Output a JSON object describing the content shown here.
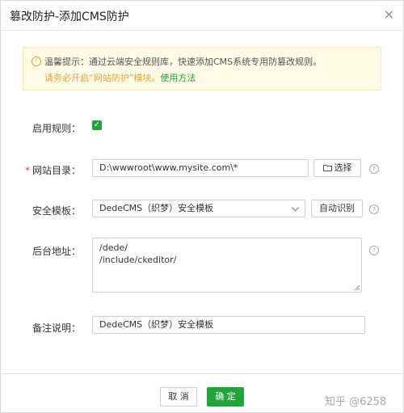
{
  "dialog": {
    "title": "篡改防护-添加CMS防护",
    "close_icon": "×"
  },
  "tip": {
    "line1": "温馨提示：通过云端安全规则库，快速添加CMS系统专用防篡改规则。",
    "line2": "请务必开启“网站防护”模块。",
    "link": "使用方法"
  },
  "form": {
    "enable_label": "启用规则：",
    "enable_checked": true,
    "site_dir_label": "网站目录：",
    "site_dir_value": "D:\\wwwroot\\www.mysite.com\\*",
    "select_btn": "选择",
    "template_label": "安全模板：",
    "template_value": "DedeCMS（织梦）安全模板",
    "auto_detect_btn": "自动识别",
    "admin_label": "后台地址：",
    "admin_lines": [
      "/dede/",
      "/include/ckeditor/"
    ],
    "remark_label": "备注说明：",
    "remark_value": "DedeCMS（织梦）安全模板"
  },
  "footer": {
    "cancel": "取 消",
    "ok": "确 定"
  },
  "watermark": "知乎 @6258",
  "colors": {
    "accent": "#20a53a",
    "warning": "#e6a23c",
    "required": "#e64340"
  }
}
